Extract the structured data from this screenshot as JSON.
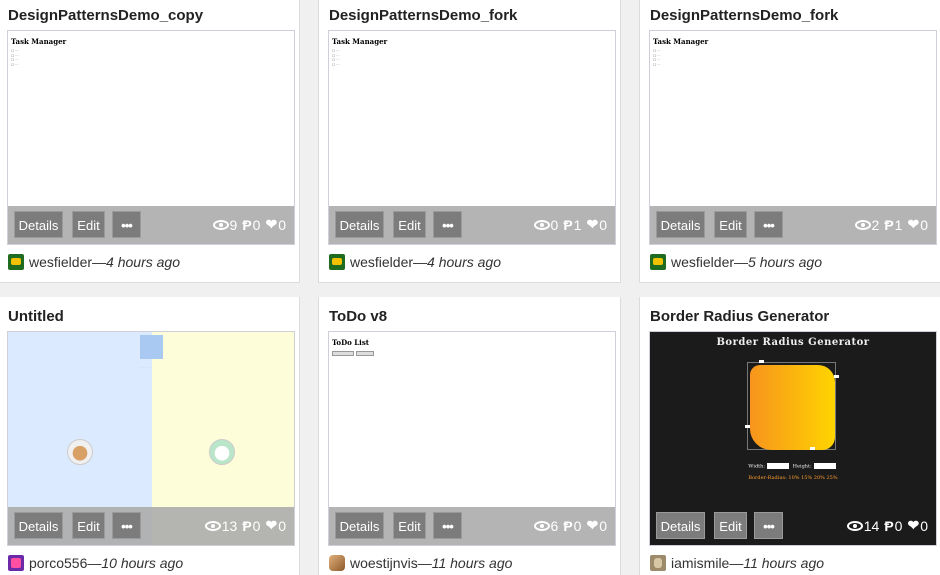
{
  "cards": [
    {
      "title": "DesignPatternsDemo_copy",
      "views": "9",
      "forks": "0",
      "likes": "0",
      "author": "wesfielder",
      "time": "4 hours ago",
      "preview_heading": "Task Manager"
    },
    {
      "title": "DesignPatternsDemo_fork",
      "views": "0",
      "forks": "1",
      "likes": "0",
      "author": "wesfielder",
      "time": "4 hours ago",
      "preview_heading": "Task Manager"
    },
    {
      "title": "DesignPatternsDemo_fork",
      "views": "2",
      "forks": "1",
      "likes": "0",
      "author": "wesfielder",
      "time": "5 hours ago",
      "preview_heading": "Task Manager"
    },
    {
      "title": "Untitled",
      "views": "13",
      "forks": "0",
      "likes": "0",
      "author": "porco556",
      "time": "10 hours ago"
    },
    {
      "title": "ToDo v8",
      "views": "6",
      "forks": "0",
      "likes": "0",
      "author": "woestijnvis",
      "time": "11 hours ago",
      "preview_heading": "ToDo List"
    },
    {
      "title": "Border Radius Generator",
      "views": "14",
      "forks": "0",
      "likes": "0",
      "author": "iamismile",
      "time": "11 hours ago",
      "preview_heading": "Border Radius Generator",
      "preview_width_label": "Width:",
      "preview_height_label": "Height:",
      "preview_css": "Border-Radius: 10% 15% 20% 25%"
    }
  ],
  "labels": {
    "details": "Details",
    "edit": "Edit",
    "more": "•••",
    "fork_glyph": "Ᵽ",
    "heart_glyph": "❤",
    "separator": " — "
  },
  "colors": {
    "bar": "#aaaaaa",
    "button": "#7c7c7c",
    "accent_orange": "#f7941d"
  }
}
